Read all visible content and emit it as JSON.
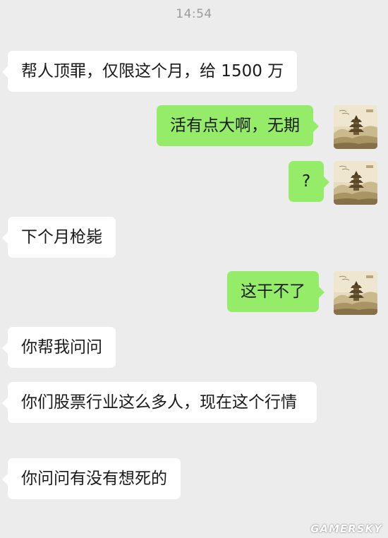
{
  "status": {
    "time": "14:54"
  },
  "messages": [
    {
      "side": "in",
      "text": "帮人顶罪，仅限这个月，给 1500 万"
    },
    {
      "side": "out",
      "text": "活有点大啊，无期"
    },
    {
      "side": "out",
      "text": "?"
    },
    {
      "side": "in",
      "text": "下个月枪毙"
    },
    {
      "side": "out",
      "text": "这干不了"
    },
    {
      "side": "in",
      "text": "你帮我问问"
    },
    {
      "side": "in",
      "text": "你们股票行业这么多人，现在这个行情"
    },
    {
      "side": "in",
      "text": "你问问有没有想死的"
    }
  ],
  "avatar": {
    "icon": "pagoda-landscape-avatar-icon"
  },
  "watermark": {
    "text": "GAMERSKY"
  }
}
